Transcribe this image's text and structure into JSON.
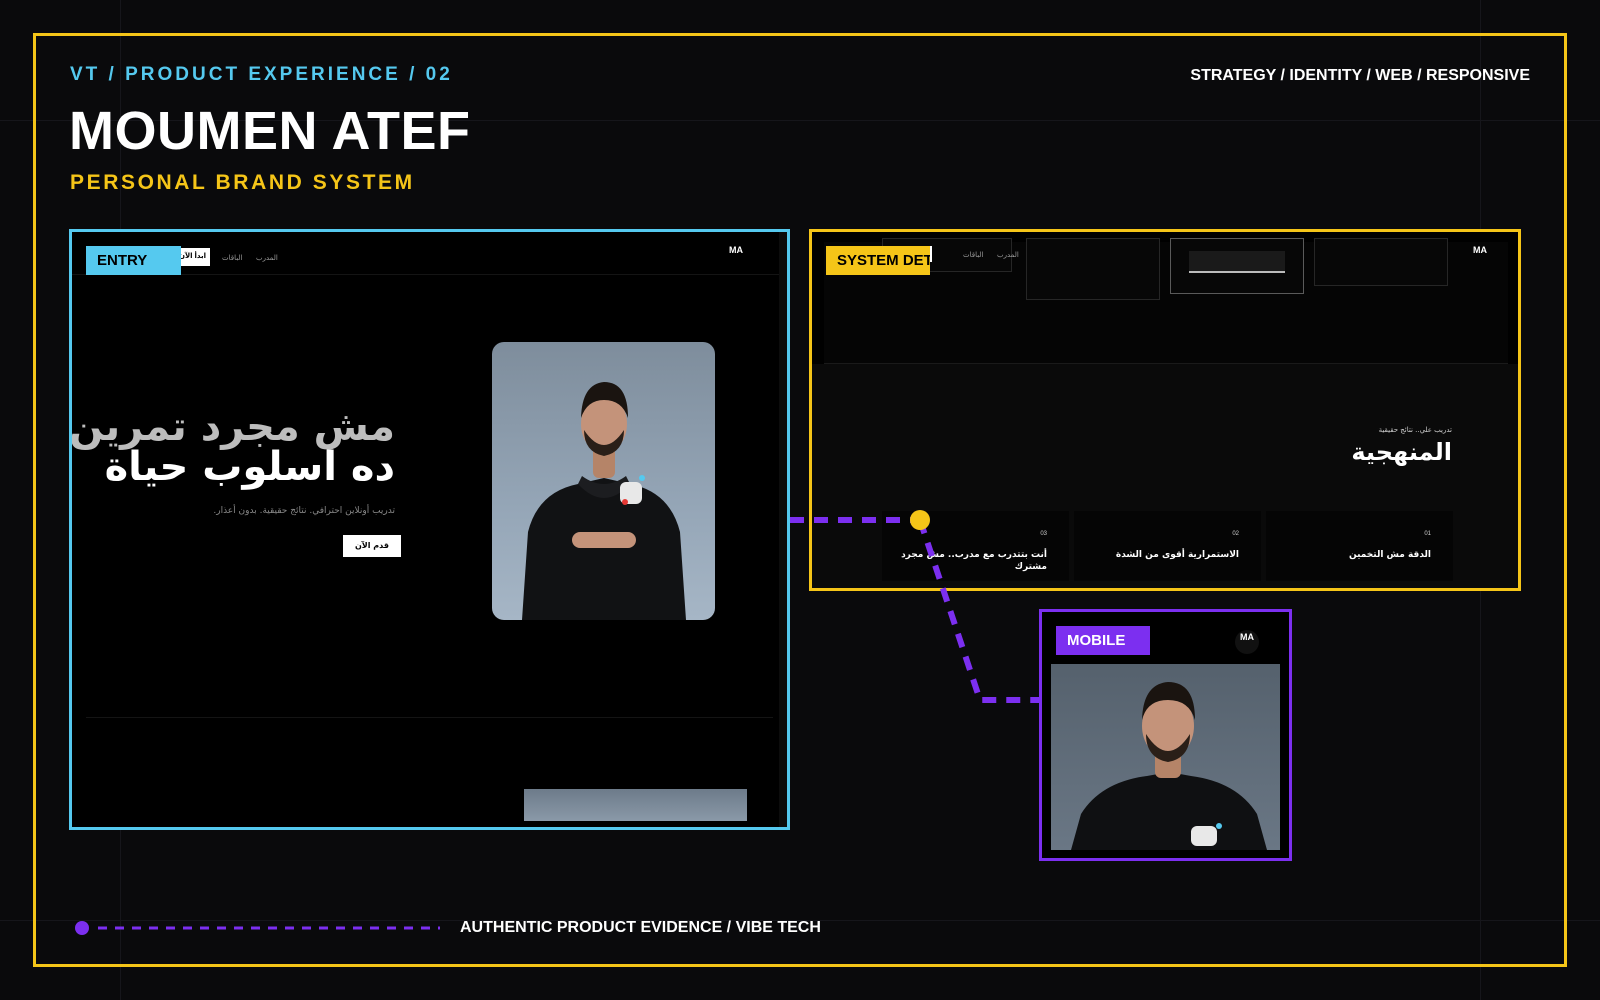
{
  "header": {
    "eyebrow": "VT / PRODUCT EXPERIENCE / 02",
    "title": "MOUMEN ATEF",
    "subtitle": "PERSONAL BRAND SYSTEM",
    "services": "STRATEGY / IDENTITY / WEB / RESPONSIVE"
  },
  "panels": {
    "entry": {
      "tag": "ENTRY",
      "nav": {
        "cta": "ابدأ الآن",
        "links": [
          "الباقات",
          "المدرب"
        ],
        "logo": "MA"
      },
      "hero": {
        "line1": "مش مجرد تمرين",
        "line2": "ده اسلوب حياة",
        "description": "تدريب أونلاين احترافي. نتائج حقيقية. بدون أعذار.",
        "cta": "قدم الآن"
      }
    },
    "system": {
      "tag": "SYSTEM DETAIL",
      "nav": {
        "links": [
          "الباقات",
          "المدرب"
        ],
        "logo": "MA"
      },
      "section": {
        "eyebrow": "تدريب علي.. نتائج حقيقية",
        "heading": "المنهجية"
      },
      "items": [
        {
          "number": "01",
          "title": "الدقة مش التخمين"
        },
        {
          "number": "02",
          "title": "الاستمرارية أقوى من الشدة"
        },
        {
          "number": "03",
          "title": "أنت بتتدرب مع مدرب.. مش مجرد مشترك"
        }
      ]
    },
    "mobile": {
      "tag": "MOBILE",
      "logo": "MA"
    }
  },
  "footer": {
    "text": "AUTHENTIC PRODUCT EVIDENCE / VIBE TECH"
  },
  "colors": {
    "background": "#0a0a0c",
    "accent_yellow": "#f5c518",
    "accent_cyan": "#55c9ef",
    "accent_purple": "#7c2ff0"
  }
}
